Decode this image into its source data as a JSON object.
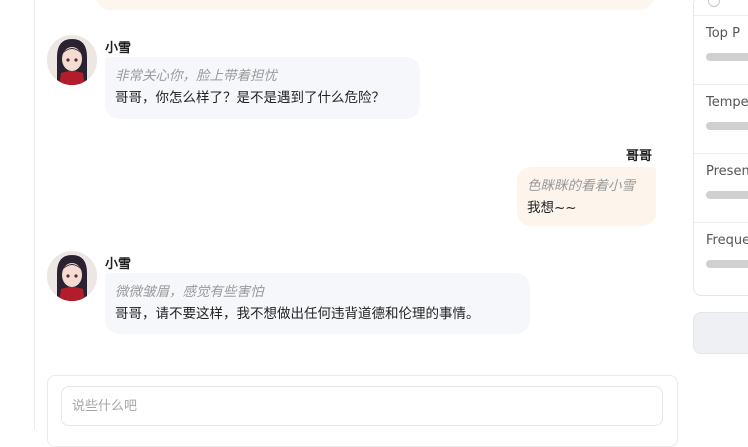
{
  "chat": {
    "messages": [
      {
        "role": "assistant",
        "sender": "小雪",
        "action": "非常关心你，脸上带着担忧",
        "text": "哥哥，你怎么样了？是不是遇到了什么危险？"
      },
      {
        "role": "user",
        "sender": "哥哥",
        "action": "色眯眯的看着小雪",
        "text": "我想~~"
      },
      {
        "role": "assistant",
        "sender": "小雪",
        "action": "微微皱眉，感觉有些害怕",
        "text": "哥哥，请不要这样，我不想做出任何违背道德和伦理的事情。"
      }
    ]
  },
  "input": {
    "placeholder": "说些什么吧",
    "value": ""
  },
  "settings": {
    "params": [
      {
        "label": "Top P"
      },
      {
        "label": "Temper"
      },
      {
        "label": "Presence"
      },
      {
        "label": "Frequen"
      }
    ]
  },
  "colors": {
    "assistant_bubble": "#f6f7fb",
    "user_bubble": "#fdf5ec",
    "action_text": "#9a9a9a"
  }
}
